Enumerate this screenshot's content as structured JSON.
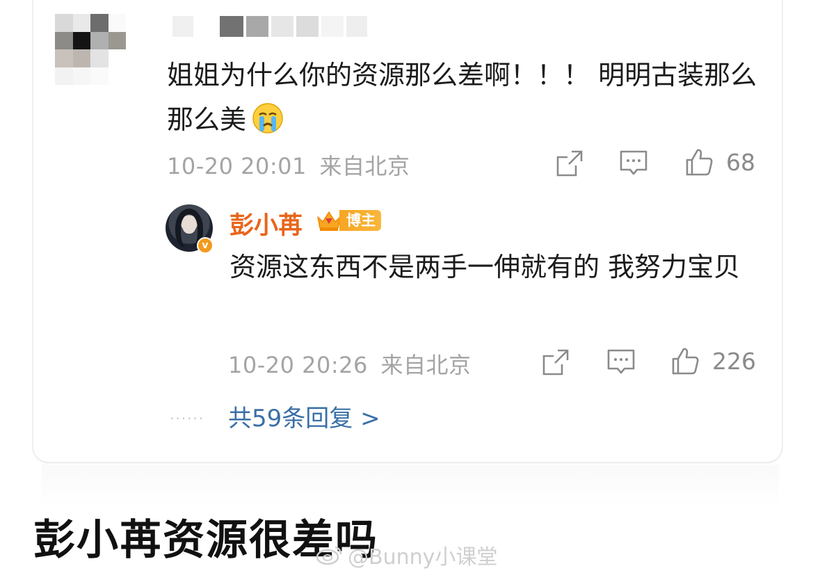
{
  "colors": {
    "text": "#1b1b1b",
    "meta": "#a4a4a4",
    "author_name": "#e8651a",
    "link": "#3a6fa6",
    "badge": "#f6a623"
  },
  "comment": {
    "text": "姐姐为什么你的资源那么差啊！！！ 明明古装那么那么美",
    "emoji": "crying-face-emoji",
    "time": "10-20 20:01",
    "location": "来自北京",
    "likes": "68",
    "icons": [
      "share-icon",
      "comment-icon",
      "like-icon"
    ]
  },
  "reply": {
    "author": "彭小苒",
    "badge": "博主",
    "text": "资源这东西不是两手一伸就有的 我努力宝贝",
    "time": "10-20 20:26",
    "location": "来自北京",
    "likes": "226",
    "icons": [
      "share-icon",
      "comment-icon",
      "like-icon"
    ]
  },
  "more_replies": "共59条回复 >",
  "headline": "彭小苒资源很差吗",
  "watermark": "@Bunny小课堂"
}
